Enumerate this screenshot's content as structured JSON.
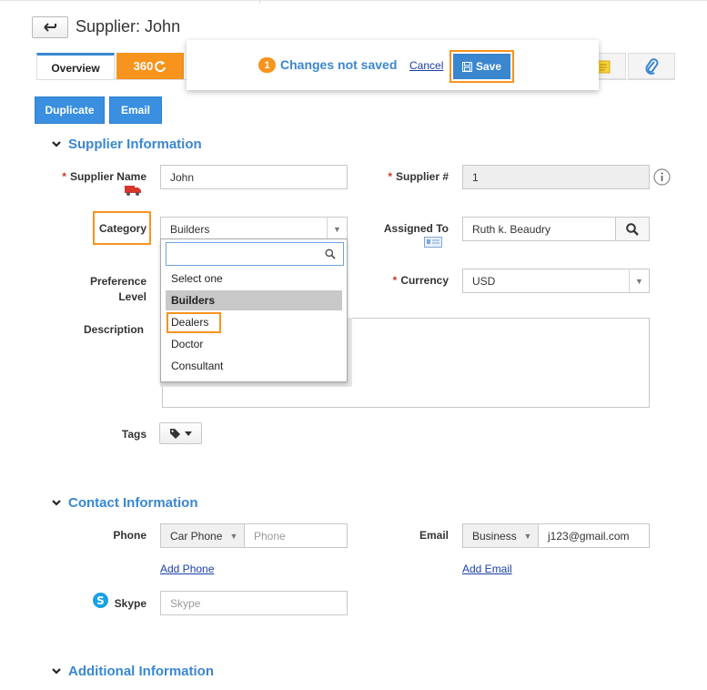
{
  "header": {
    "title": "Supplier: John"
  },
  "tabs": {
    "overview": "Overview",
    "tab360": "360"
  },
  "notice": {
    "count": "1",
    "text": "Changes not saved",
    "cancel": "Cancel",
    "save": "Save"
  },
  "actions": {
    "duplicate": "Duplicate",
    "email": "Email"
  },
  "supplier_info": {
    "title": "Supplier Information",
    "supplier_name_label": "Supplier Name",
    "supplier_name_value": "John",
    "supplier_num_label": "Supplier #",
    "supplier_num_value": "1",
    "category_label": "Category",
    "category_value": "Builders",
    "assigned_to_label": "Assigned To",
    "assigned_to_value": "Ruth k. Beaudry",
    "preference_label_1": "Preference",
    "preference_label_2": "Level",
    "currency_label": "Currency",
    "currency_value": "USD",
    "description_label": "Description",
    "tags_label": "Tags",
    "category_options": [
      "Select one",
      "Builders",
      "Dealers",
      "Doctor",
      "Consultant"
    ]
  },
  "contact_info": {
    "title": "Contact Information",
    "phone_label": "Phone",
    "phone_type": "Car Phone",
    "phone_placeholder": "Phone",
    "add_phone": "Add Phone",
    "email_label": "Email",
    "email_type": "Business",
    "email_value": "j123@gmail.com",
    "add_email": "Add Email",
    "skype_label": "Skype",
    "skype_placeholder": "Skype"
  },
  "additional_info": {
    "title": "Additional Information"
  },
  "colors": {
    "accent": "#3a87d0",
    "orange": "#f7941d",
    "required": "#d0342c"
  }
}
